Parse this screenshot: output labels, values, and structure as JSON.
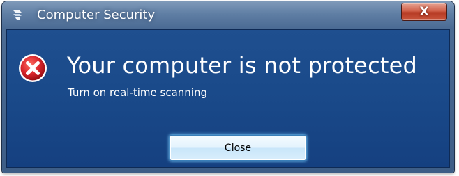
{
  "window": {
    "title": "Computer Security",
    "close_glyph": "X"
  },
  "message": {
    "headline": "Your computer is not protected",
    "subline": "Turn on real-time scanning"
  },
  "buttons": {
    "close_label": "Close"
  },
  "icons": {
    "app": "security-shield-icon",
    "status": "error-icon"
  },
  "colors": {
    "content_background": "#1a4a8a",
    "titlebar": "#5f7ea4",
    "error_red": "#d9262c",
    "close_button_red": "#c9553c"
  }
}
